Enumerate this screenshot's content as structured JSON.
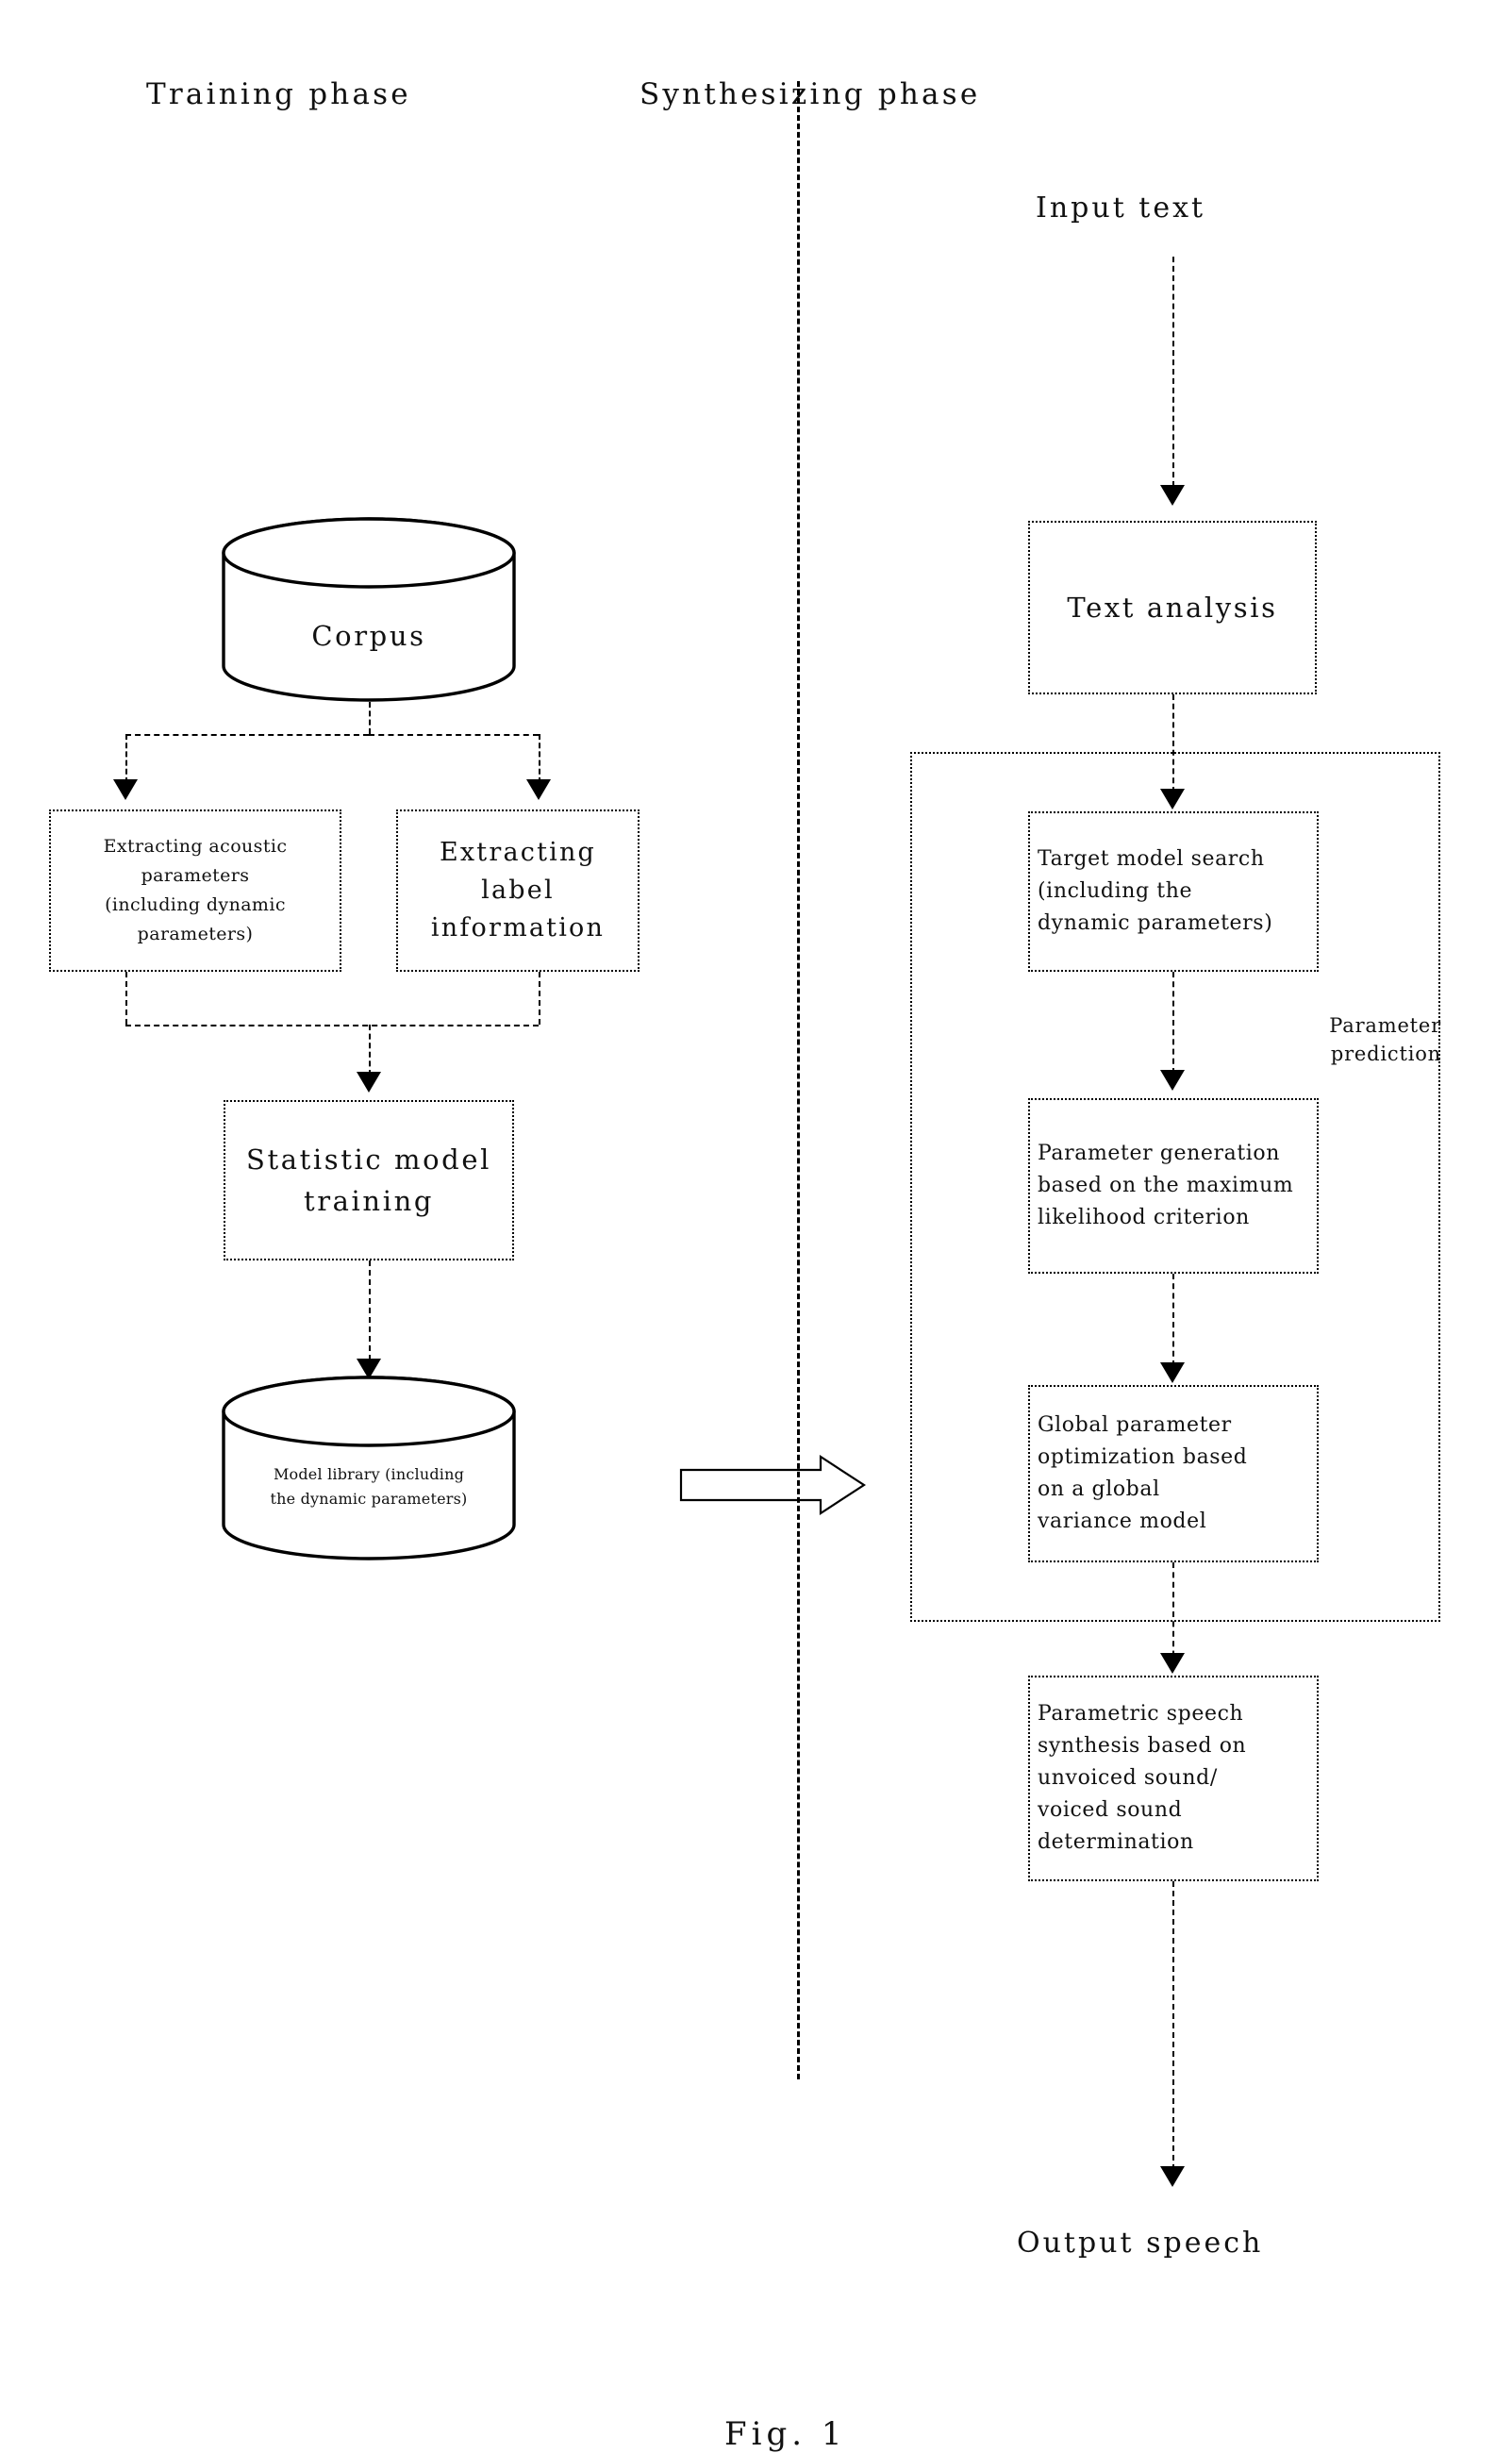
{
  "figure": {
    "caption": "Fig. 1"
  },
  "phases": {
    "training": {
      "title": "Training phase",
      "corpus_label": "Corpus",
      "extract_acoustic": "Extracting acoustic\nparameters\n(including dynamic\nparameters)",
      "extract_label": "Extracting label\ninformation",
      "statistic_training": "Statistic model\ntraining",
      "model_library": "Model library (including\nthe dynamic parameters)"
    },
    "synthesizing": {
      "title": "Synthesizing phase",
      "input_text": "Input text",
      "text_analysis": "Text analysis",
      "target_model_search": "Target model search\n(including the\ndynamic parameters)",
      "parameter_prediction_label": "Parameter\nprediction",
      "parameter_generation": "Parameter generation\nbased on the maximum\nlikelihood criterion",
      "global_optimization": "Global parameter\noptimization based\non a global\nvariance model",
      "parametric_synthesis": "Parametric speech\nsynthesis based on\nunvoiced sound/\nvoiced sound\ndetermination",
      "output_speech": "Output speech"
    }
  },
  "colors": {
    "ink": "#000000",
    "paper": "#ffffff"
  }
}
